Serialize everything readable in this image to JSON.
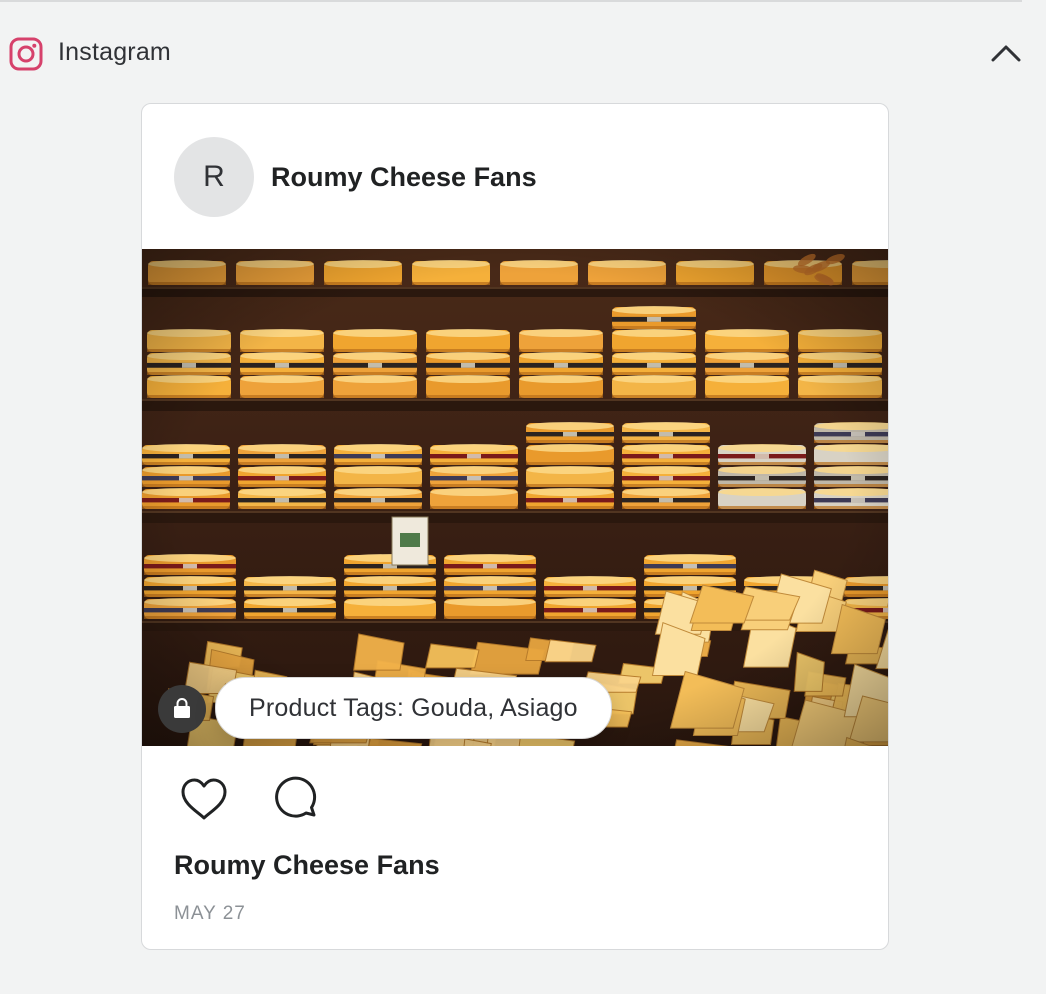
{
  "section": {
    "title": "Instagram",
    "icon": "instagram-icon",
    "collapse_icon": "chevron-up-icon",
    "brand_color": "#d6416b"
  },
  "post": {
    "avatar_initial": "R",
    "account_name": "Roumy Cheese Fans",
    "image_icon": "shopping-bag-icon",
    "product_tags": "Product Tags: Gouda, Asiago",
    "like_icon": "heart-icon",
    "comment_icon": "comment-icon",
    "footer_account_name": "Roumy Cheese Fans",
    "date": "MAY 27"
  }
}
